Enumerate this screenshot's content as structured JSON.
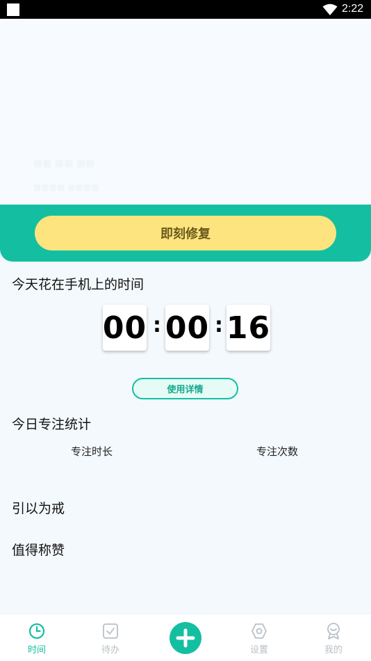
{
  "status_bar": {
    "time": "2:22",
    "wifi_icon": "wifi-icon"
  },
  "hero": {
    "faint_title": "■■ ■■ ■■",
    "faint_subtitle": "■■■■ ■■■■"
  },
  "repair_button": "即刻修复",
  "phone_time": {
    "title": "今天花在手机上的时间",
    "hours": "00",
    "minutes": "00",
    "seconds": "16",
    "separator": ":"
  },
  "usage_detail_button": "使用详情",
  "focus_stats": {
    "title": "今日专注统计",
    "duration_label": "专注时长",
    "count_label": "专注次数"
  },
  "warning_section": {
    "title": "引以为戒"
  },
  "praise_section": {
    "title": "值得称赞"
  },
  "tabbar": {
    "items": [
      {
        "label": "时间",
        "icon": "clock-icon",
        "active": true
      },
      {
        "label": "待办",
        "icon": "checklist-icon",
        "active": false
      },
      {
        "label": "",
        "icon": "plus-icon",
        "active": false
      },
      {
        "label": "设置",
        "icon": "hexagon-settings-icon",
        "active": false
      },
      {
        "label": "我的",
        "icon": "profile-badge-icon",
        "active": false
      }
    ]
  },
  "colors": {
    "accent": "#14bfa1",
    "button_yellow": "#fde47f",
    "inactive_tab": "#b9c0c6"
  }
}
